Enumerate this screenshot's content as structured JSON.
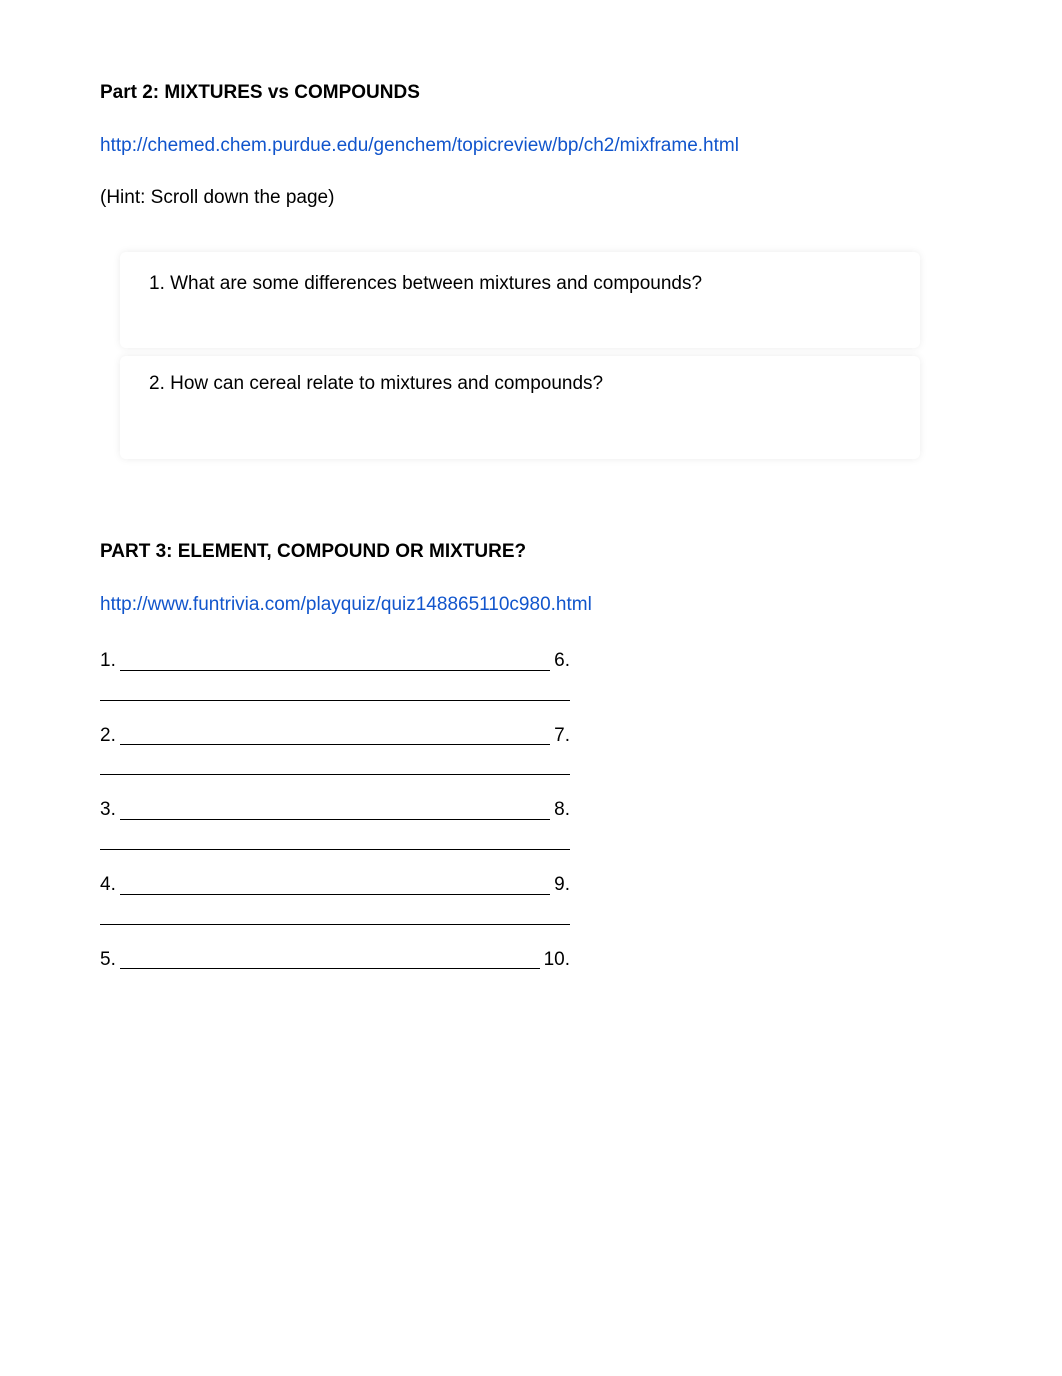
{
  "part2": {
    "heading": "Part 2: MIXTURES vs COMPOUNDS",
    "link": "http://chemed.chem.purdue.edu/genchem/topicreview/bp/ch2/mixframe.html",
    "hint": "(Hint: Scroll down the page)",
    "q1": "1. What are some differences between mixtures and compounds?",
    "q2": "2. How can cereal relate to mixtures and compounds?"
  },
  "part3": {
    "heading": "PART 3: ELEMENT, COMPOUND OR MIXTURE?",
    "link": "http://www.funtrivia.com/playquiz/quiz148865110c980.html",
    "blanks": [
      {
        "left": "1.",
        "right": "6."
      },
      {
        "left": "2.",
        "right": "7."
      },
      {
        "left": "3.",
        "right": "8."
      },
      {
        "left": "4.",
        "right": "9."
      },
      {
        "left": "5.",
        "right": "10."
      }
    ]
  }
}
